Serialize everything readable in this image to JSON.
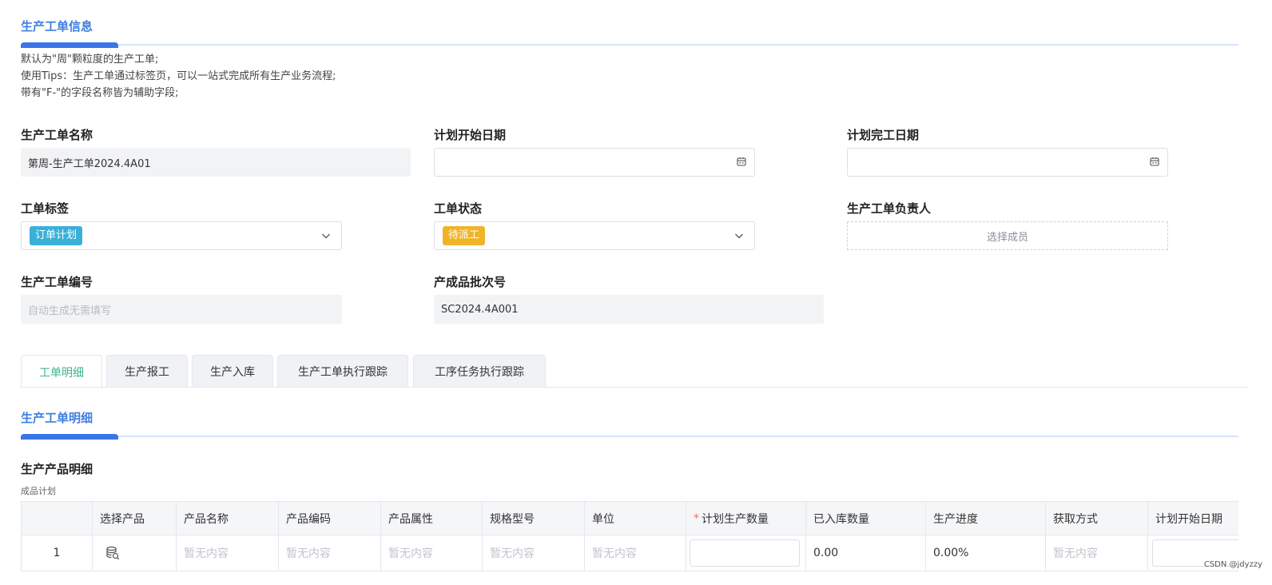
{
  "section_info": {
    "title": "生产工单信息"
  },
  "description": {
    "lines": [
      "默认为\"周\"颗粒度的生产工单;",
      "使用Tips：生产工单通过标签页，可以一站式完成所有生产业务流程;",
      "带有\"F-\"的字段名称皆为辅助字段;"
    ]
  },
  "fields": {
    "order_name": {
      "label": "生产工单名称",
      "value": "第周-生产工单2024.4A01"
    },
    "plan_start": {
      "label": "计划开始日期",
      "value": ""
    },
    "plan_finish": {
      "label": "计划完工日期",
      "value": ""
    },
    "order_tag": {
      "label": "工单标签",
      "value": "订单计划",
      "color": "#3ab0d9"
    },
    "order_status": {
      "label": "工单状态",
      "value": "待派工",
      "color": "#f0b429"
    },
    "owner": {
      "label": "生产工单负责人",
      "placeholder": "选择成员"
    },
    "order_no": {
      "label": "生产工单编号",
      "placeholder": "自动生成无需填写"
    },
    "batch_no": {
      "label": "产成品批次号",
      "value": "SC2024.4A001"
    }
  },
  "tabs": [
    {
      "label": "工单明细",
      "active": true
    },
    {
      "label": "生产报工",
      "active": false
    },
    {
      "label": "生产入库",
      "active": false
    },
    {
      "label": "生产工单执行跟踪",
      "active": false
    },
    {
      "label": "工序任务执行跟踪",
      "active": false
    }
  ],
  "section_detail": {
    "title": "生产工单明细"
  },
  "product_detail": {
    "title": "生产产品明细",
    "subtitle": "成品计划"
  },
  "table": {
    "columns": [
      "",
      "选择产品",
      "产品名称",
      "产品编码",
      "产品属性",
      "规格型号",
      "单位",
      "计划生产数量",
      "已入库数量",
      "生产进度",
      "获取方式",
      "计划开始日期"
    ],
    "required_column": "计划生产数量",
    "row": {
      "index": "1",
      "select_icon": "database-select-icon",
      "empty_text": "暂无内容",
      "stored_qty": "0.00",
      "progress": "0.00%"
    }
  },
  "watermark": "CSDN @jdyzzy",
  "colors": {
    "accent": "#3a76e8",
    "active_tab": "#3ab68a",
    "tag": "#3ab0d9",
    "status": "#f0b429"
  }
}
